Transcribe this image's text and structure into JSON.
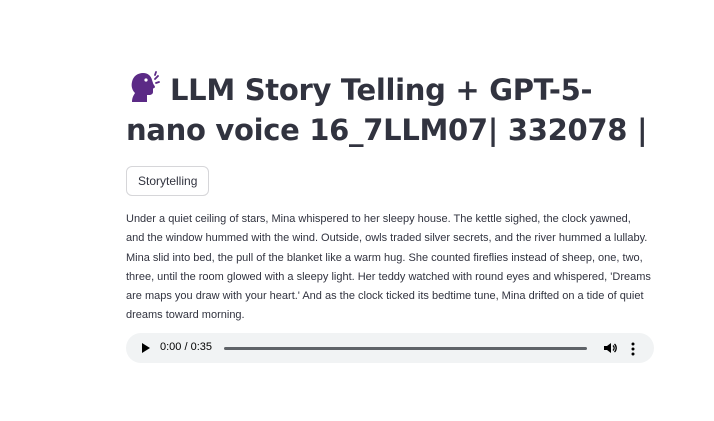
{
  "header": {
    "title": "LLM Story Telling + GPT-5-nano voice 16_7LLM07| 332078 |",
    "title_icon": "speaking-head-icon"
  },
  "tag": {
    "label": "Storytelling"
  },
  "story": {
    "text": "Under a quiet ceiling of stars, Mina whispered to her sleepy house. The kettle sighed, the clock yawned, and the window hummed with the wind. Outside, owls traded silver secrets, and the river hummed a lullaby. Mina slid into bed, the pull of the blanket like a warm hug. She counted fireflies instead of sheep, one, two, three, until the room glowed with a sleepy light. Her teddy watched with round eyes and whispered, 'Dreams are maps you draw with your heart.' And as the clock ticked its bedtime tune, Mina drifted on a tide of quiet dreams toward morning."
  },
  "audio": {
    "time": "0:00 / 0:35",
    "progress": 0,
    "play_icon": "play-icon",
    "volume_icon": "volume-icon",
    "more_icon": "more-vertical-icon"
  },
  "colors": {
    "text": "#31333f",
    "emoji_purple": "#5b2a86",
    "player_bg": "#f1f3f4"
  }
}
